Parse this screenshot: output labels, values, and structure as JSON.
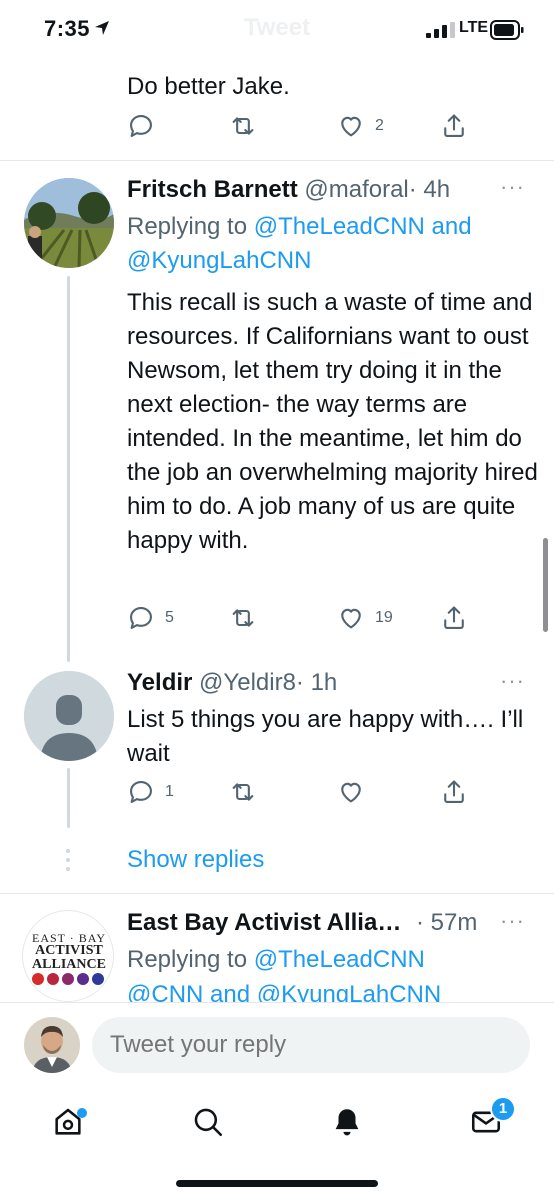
{
  "status_bar": {
    "time": "7:35",
    "ghost_title": "Tweet",
    "network": "LTE"
  },
  "tweet_top": {
    "text": "Do better Jake.",
    "likes": "2"
  },
  "tweet_fritsch": {
    "name": "Fritsch Barnett",
    "handle": "@maforal",
    "time": "· 4h",
    "replying_prefix": "Replying to ",
    "replying_1": "@TheLeadCNN",
    "replying_and": " and",
    "replying_2": "@KyungLahCNN",
    "body": "This recall is such a waste of time and resources. If Californians want to oust Newsom, let them try doing it in the next election- the way terms are intended. In the meantime, let him do the job an overwhelming majority hired him to do. A job many of us are quite happy with.",
    "replies": "5",
    "likes": "19"
  },
  "tweet_yeldir": {
    "name": "Yeldir",
    "handle": "@Yeldir8",
    "time": "· 1h",
    "body": "List 5 things you are happy with…. I’ll wait",
    "replies": "1"
  },
  "show_replies": "Show replies",
  "tweet_eastbay": {
    "name": "East Bay Activist Allia…",
    "time": "· 57m",
    "replying_prefix": "Replying to ",
    "replying_1": "@TheLeadCNN",
    "replying_line2": "@CNN and @KyungLahCNN",
    "logo_line1": "EAST · BAY",
    "logo_line2": "ACTIVIST",
    "logo_line3": "ALLIANCE"
  },
  "reply_bar": {
    "placeholder": "Tweet your reply"
  },
  "tab_bar": {
    "messages_badge": "1"
  },
  "colors": {
    "accent": "#1d9bf0",
    "text": "#0f1419",
    "muted": "#536471"
  }
}
